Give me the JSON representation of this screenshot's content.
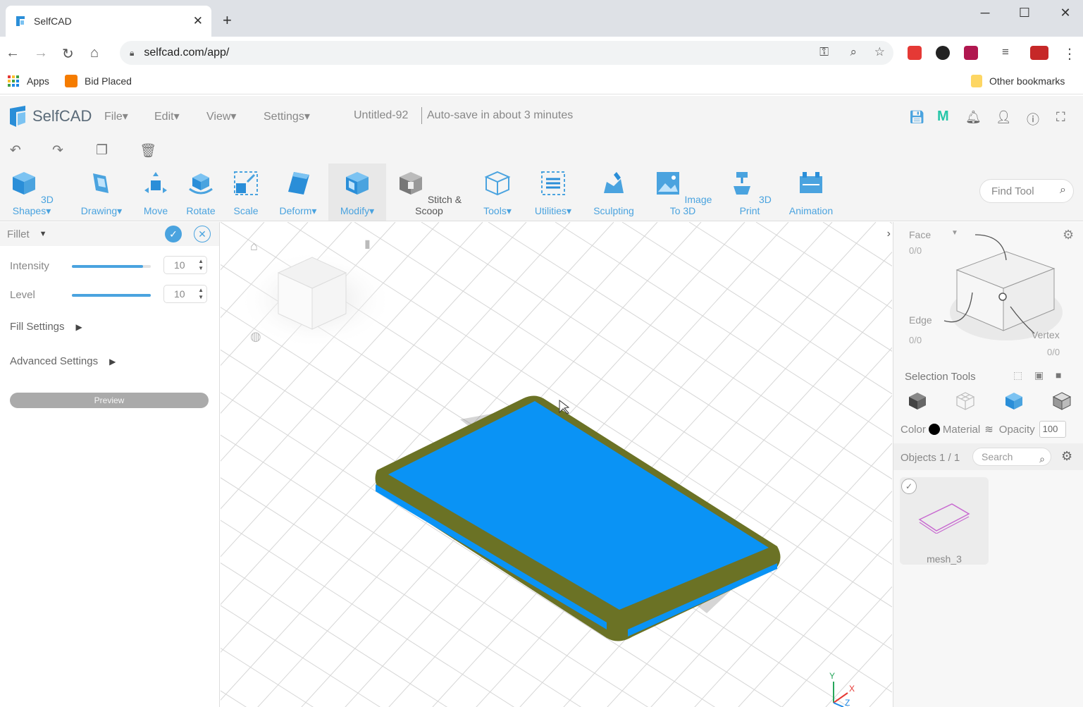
{
  "browser": {
    "tab_title": "SelfCAD",
    "url": "selfcad.com/app/",
    "bookmarks": [
      {
        "label": "Apps"
      },
      {
        "label": "Bid Placed"
      }
    ],
    "other_bookmarks": "Other bookmarks"
  },
  "app": {
    "logo_text": "SelfCAD",
    "menu": [
      "File▾",
      "Edit▾",
      "View▾",
      "Settings▾"
    ],
    "file_name": "Untitled-92",
    "autosave": "Auto-save in about 3 minutes"
  },
  "toolbar": {
    "tools": [
      {
        "label": "3D Shapes▾",
        "icon": "cube-icon"
      },
      {
        "label": "Drawing▾",
        "icon": "drawing-icon"
      },
      {
        "label": "Move",
        "icon": "move-icon"
      },
      {
        "label": "Rotate",
        "icon": "rotate-icon"
      },
      {
        "label": "Scale",
        "icon": "scale-icon"
      },
      {
        "label": "Deform▾",
        "icon": "deform-icon"
      },
      {
        "label": "Modify▾",
        "icon": "modify-icon"
      },
      {
        "label": "Stitch & Scoop",
        "icon": "stitch-scoop-icon"
      },
      {
        "label": "Tools▾",
        "icon": "tools-icon"
      },
      {
        "label": "Utilities▾",
        "icon": "utilities-icon"
      },
      {
        "label": "Sculpting",
        "icon": "sculpting-icon"
      },
      {
        "label": "Image To 3D",
        "icon": "image-to-3d-icon"
      },
      {
        "label": "3D Print",
        "icon": "3d-print-icon"
      },
      {
        "label": "Animation",
        "icon": "animation-icon"
      }
    ],
    "find_tool_placeholder": "Find Tool"
  },
  "fillet_panel": {
    "title": "Fillet",
    "intensity_label": "Intensity",
    "intensity_value": "10",
    "intensity_fraction": 0.9,
    "level_label": "Level",
    "level_value": "10",
    "level_fraction": 1.0,
    "fill_settings": "Fill Settings",
    "advanced_settings": "Advanced Settings",
    "preview_label": "Preview"
  },
  "viewport": {
    "axis_y": "Y",
    "axis_x": "X",
    "axis_z": "Z",
    "object_color": "#0a93f5",
    "fillet_color": "#6b7225"
  },
  "right_panel": {
    "face_label": "Face",
    "face_count": "0/0",
    "edge_label": "Edge",
    "edge_count": "0/0",
    "vertex_label": "Vertex",
    "vertex_count": "0/0",
    "selection_tools": "Selection Tools",
    "color_label": "Color",
    "material_label": "Material",
    "opacity_label": "Opacity",
    "opacity_value": "100",
    "objects_count": "Objects 1 / 1",
    "search_placeholder": "Search",
    "object_name": "mesh_3"
  },
  "colors": {
    "accent": "#4aa3df",
    "header_bg": "#f4f4f4"
  }
}
